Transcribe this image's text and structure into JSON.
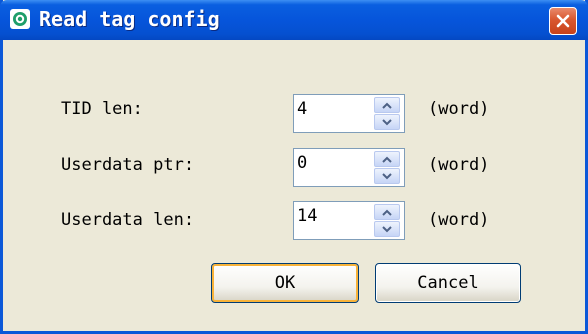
{
  "window": {
    "title": "Read tag config",
    "accent_color": "#0655db",
    "close_color": "#d9572f"
  },
  "fields": [
    {
      "label": "TID len:",
      "value": "4",
      "unit": "(word)"
    },
    {
      "label": "Userdata ptr:",
      "value": "0",
      "unit": "(word)"
    },
    {
      "label": "Userdata len:",
      "value": "14",
      "unit": "(word)"
    }
  ],
  "buttons": {
    "ok": "OK",
    "cancel": "Cancel"
  },
  "icons": {
    "app": "app-icon",
    "close": "close-icon",
    "spin_up": "chevron-up-icon",
    "spin_down": "chevron-down-icon"
  }
}
